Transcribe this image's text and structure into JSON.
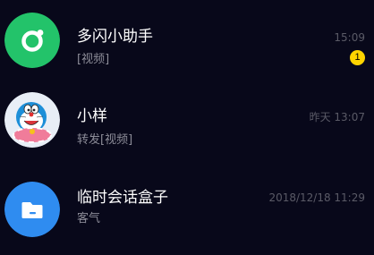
{
  "colors": {
    "background": "#08081a",
    "assistant_avatar": "#23c36a",
    "folder_avatar": "#2f8cf0",
    "unread_badge": "#ffd400"
  },
  "conversations": [
    {
      "name": "多闪小助手",
      "preview": "[视频]",
      "time": "15:09",
      "unread": "1",
      "avatar_icon": "ring-dot-icon"
    },
    {
      "name": "小样",
      "preview": "转发[视频]",
      "time": "昨天 13:07",
      "avatar_icon": "doraemon-avatar"
    },
    {
      "name": "临时会话盒子",
      "preview": "客气",
      "time": "2018/12/18 11:29",
      "avatar_icon": "folder-icon"
    }
  ]
}
